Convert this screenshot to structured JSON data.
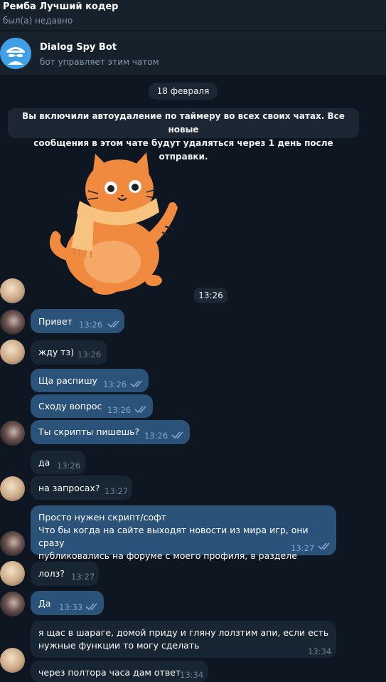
{
  "header": {
    "title": "Ремба Лучший кодер",
    "status": "был(а) недавно"
  },
  "bot_banner": {
    "name": "Dialog Spy Bot",
    "subtitle": "бот управляет этим чатом"
  },
  "date_separator": "18 февраля",
  "service_message": {
    "line1": "Вы включили автоудаление по таймеру во всех своих чатах. Все новые",
    "line2": "сообщения в этом чате будут удаляться через 1 день после отправки."
  },
  "sticker": {
    "time": "13:26",
    "icon": "cat-scarf-sticker"
  },
  "messages": [
    {
      "dir": "out",
      "text": "Привет",
      "time": "13:26",
      "read": true
    },
    {
      "dir": "in",
      "text": "жду тз)",
      "time": "13:26"
    },
    {
      "dir": "out",
      "text": "Ща распишу",
      "time": "13:26",
      "read": true
    },
    {
      "dir": "out",
      "text": "Сходу вопрос",
      "time": "13:26",
      "read": true
    },
    {
      "dir": "out",
      "text": "Ты скрипты пишешь?",
      "time": "13:26",
      "read": true
    },
    {
      "dir": "in",
      "text": "да",
      "time": "13:26"
    },
    {
      "dir": "in",
      "text": "на запросах?",
      "time": "13:27"
    },
    {
      "dir": "out",
      "lines": [
        "Просто нужен скрипт/софт",
        "Что бы когда на сайте выходят новости из мира игр, они сразу",
        "публиковались на форуме с моего профиля, в разделе"
      ],
      "time": "13:27",
      "read": true
    },
    {
      "dir": "in",
      "text": "лолз?",
      "time": "13:27"
    },
    {
      "dir": "out",
      "text": "Да",
      "time": "13:33",
      "read": true
    },
    {
      "dir": "in",
      "lines": [
        "я щас в шараге, домой приду и гляну лолзтим апи, если есть",
        "нужные функции то могу сделать"
      ],
      "time": "13:34"
    },
    {
      "dir": "in",
      "text": "через полтора часа дам ответ",
      "time": "13:34"
    }
  ]
}
